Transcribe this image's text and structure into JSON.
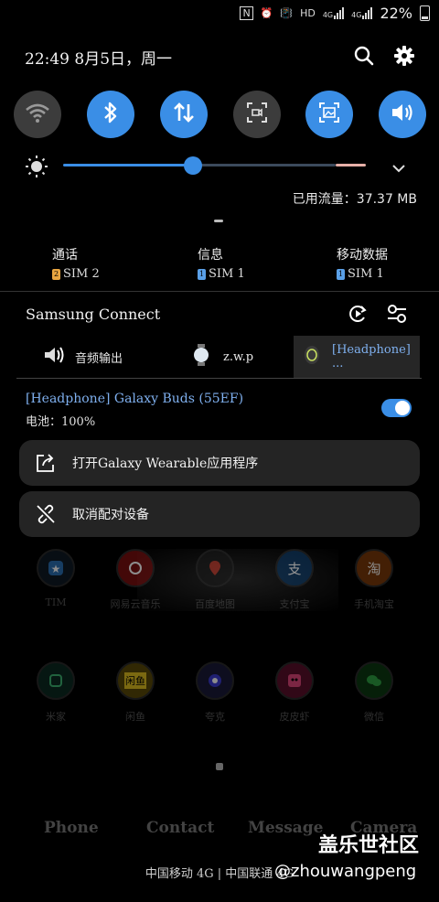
{
  "status_bar": {
    "indicators": [
      "N",
      "alarm-icon",
      "vibrate-icon",
      "HD",
      "4G",
      "4G"
    ],
    "battery_percent": "22%"
  },
  "header": {
    "datetime": "22:49  8月5日，周一"
  },
  "quick_toggles": [
    {
      "name": "wifi",
      "state": "off"
    },
    {
      "name": "bluetooth",
      "state": "on"
    },
    {
      "name": "mobile-data",
      "state": "on"
    },
    {
      "name": "screen-recorder",
      "state": "off"
    },
    {
      "name": "screenshot",
      "state": "on"
    },
    {
      "name": "sound",
      "state": "on"
    }
  ],
  "brightness": {
    "level": 0.42
  },
  "data_usage": "已用流量：37.37 MB",
  "sim": [
    {
      "label": "通话",
      "sim": "SIM 2",
      "chip": "2"
    },
    {
      "label": "信息",
      "sim": "SIM 1",
      "chip": "1"
    },
    {
      "label": "移动数据",
      "sim": "SIM 1",
      "chip": "1"
    }
  ],
  "samsung_connect": {
    "title": "Samsung Connect",
    "tabs": [
      {
        "label": "音频输出"
      },
      {
        "label": "z.w.p"
      },
      {
        "label": "[Headphone] ..."
      }
    ],
    "device": {
      "name": "[Headphone] Galaxy Buds (55EF)",
      "battery": "电池：100%",
      "enabled": true
    },
    "actions": [
      {
        "label": "打开Galaxy Wearable应用程序"
      },
      {
        "label": "取消配对设备"
      }
    ]
  },
  "background_apps": {
    "row1": [
      "TIM",
      "网易云音乐",
      "百度地图",
      "支付宝",
      "手机淘宝"
    ],
    "row2": [
      "米家",
      "闲鱼",
      "夸克",
      "皮皮虾",
      "微信"
    ]
  },
  "dock": [
    "Phone",
    "Contact",
    "Message",
    "Camera"
  ],
  "carrier_text": "中国移动 4G | 中国联通 4G",
  "watermark": {
    "site": "盖乐世社区",
    "user": "@zhouwangpeng"
  },
  "colors": {
    "accent": "#3a8ee6",
    "active_text": "#7fb0ef",
    "sim_chip": "#e8a540",
    "sim_chip_blue": "#5aa0e8"
  }
}
